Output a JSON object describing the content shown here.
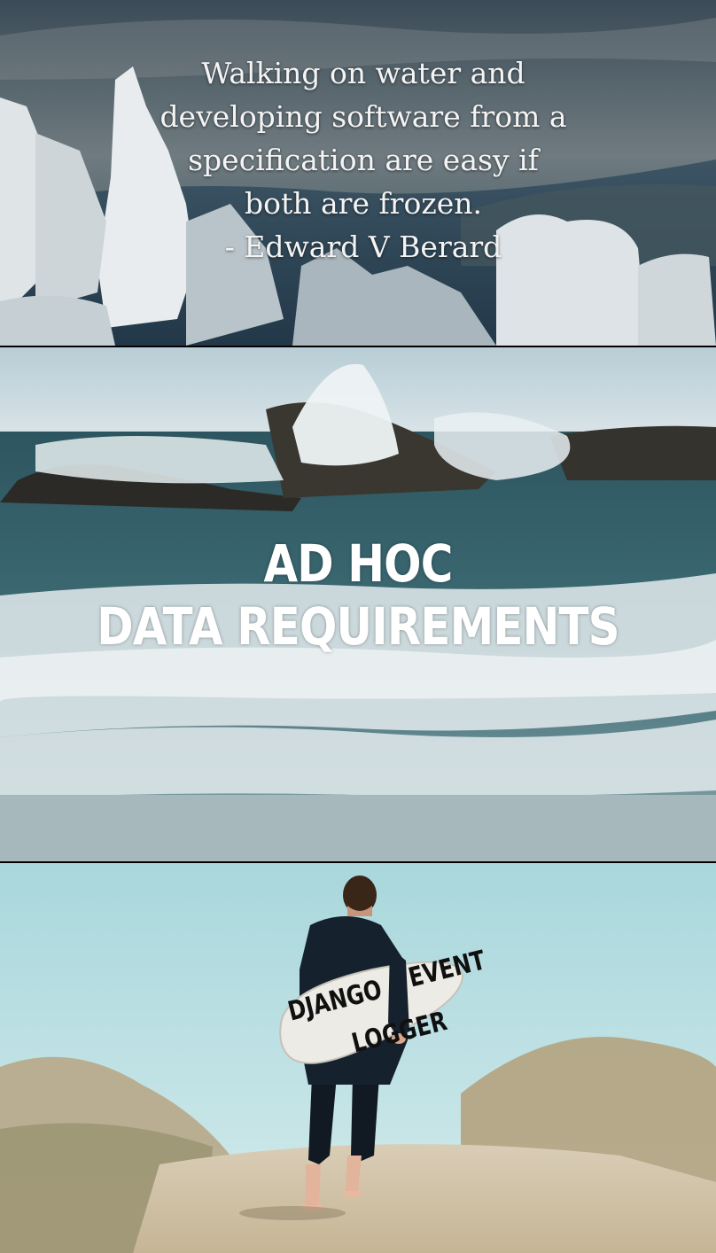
{
  "panels": {
    "quote": {
      "lines": [
        "Walking on water and",
        "developing software from a",
        "specification are easy if",
        "both are frozen.",
        "- Edward V Berard"
      ]
    },
    "waves": {
      "line1": "AD HOC",
      "line2": "DATA REQUIREMENTS"
    },
    "surfer": {
      "board_left": "DJANGO",
      "board_right_top": "EVENT",
      "board_right_bottom": "LOGGER"
    }
  },
  "colors": {
    "quote_text": "#f4f4f4",
    "caption_text": "#ffffff",
    "board_text": "#101010"
  }
}
